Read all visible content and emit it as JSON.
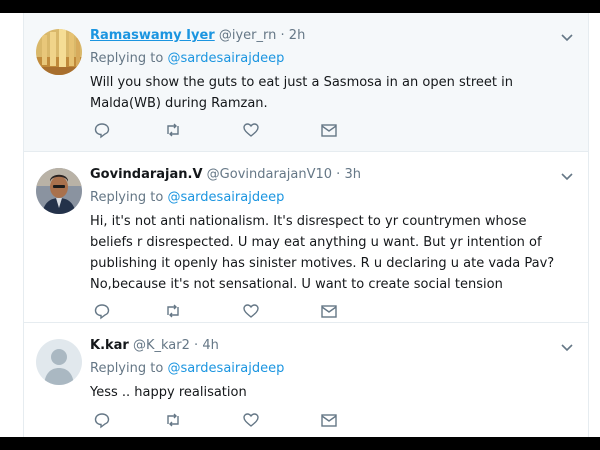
{
  "tweets": [
    {
      "name": "Ramaswamy Iyer",
      "handle": "@iyer_rn",
      "separator": "·",
      "time": "2h",
      "replying_prefix": "Replying to",
      "replying_to": "@sardesairajdeep",
      "text": "Will you show the guts to eat just a Sasmosa in an open street in Malda(WB) during Ramzan."
    },
    {
      "name": "Govindarajan.V",
      "handle": "@GovindarajanV10",
      "separator": "·",
      "time": "3h",
      "replying_prefix": "Replying to",
      "replying_to": "@sardesairajdeep",
      "text": "Hi, it's not anti nationalism. It's disrespect to yr countrymen whose beliefs r disrespected. U may eat anything u want. But yr intention of publishing it openly has sinister motives. R u declaring u ate vada Pav? No,because it's not sensational. U want to create social tension"
    },
    {
      "name": "K.kar",
      "handle": "@K_kar2",
      "separator": "·",
      "time": "4h",
      "replying_prefix": "Replying to",
      "replying_to": "@sardesairajdeep",
      "text": "Yess .. happy realisation"
    }
  ],
  "icons": {
    "reply": "reply-icon",
    "retweet": "retweet-icon",
    "like": "heart-icon",
    "dm": "envelope-icon",
    "menu": "chevron-down-icon"
  },
  "colors": {
    "link": "#1b95e0",
    "muted": "#657786",
    "text": "#14171a",
    "highlight_bg": "#f5f8fa"
  }
}
